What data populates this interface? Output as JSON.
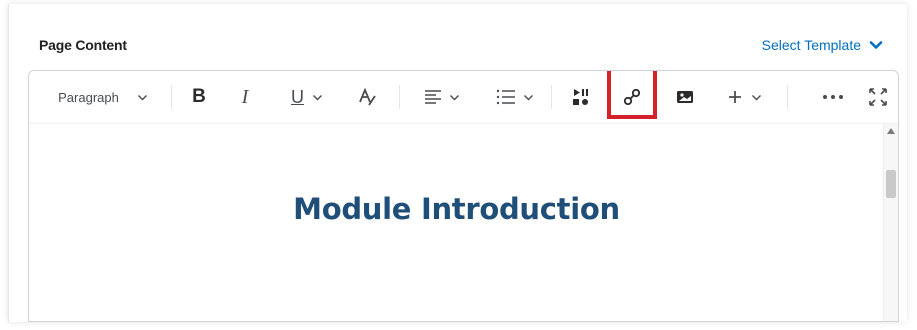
{
  "header": {
    "label": "Page Content",
    "select_template": "Select Template"
  },
  "toolbar": {
    "format_select": "Paragraph",
    "buttons": [
      {
        "name": "bold",
        "glyph": "B"
      },
      {
        "name": "italic",
        "glyph": "I"
      },
      {
        "name": "underline",
        "glyph": "U"
      },
      {
        "name": "text-style",
        "glyph": "A"
      }
    ],
    "highlighted_button": "insert-link"
  },
  "content": {
    "heading": "Module Introduction"
  },
  "colors": {
    "accent": "#006fbf",
    "heading": "#1f4e79",
    "highlight": "#d4202a"
  }
}
